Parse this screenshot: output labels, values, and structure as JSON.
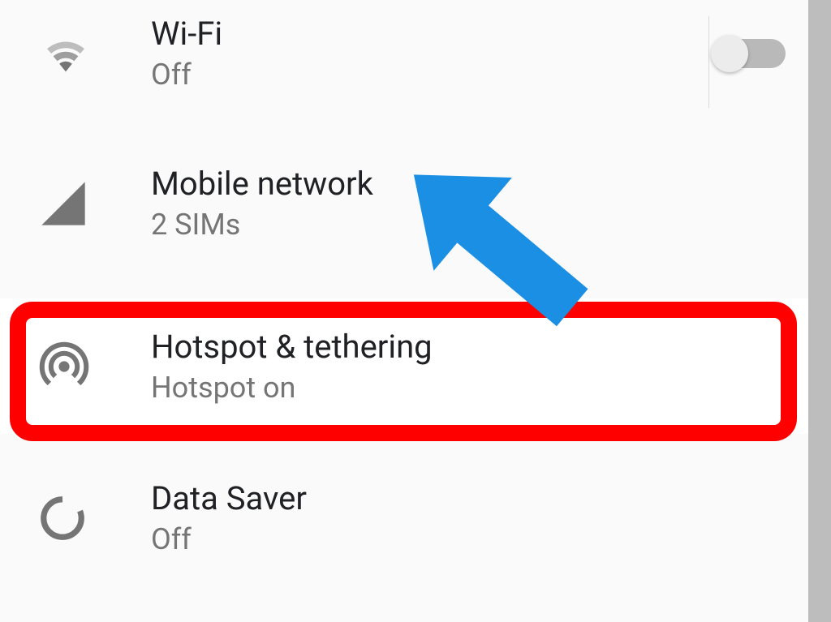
{
  "settings": {
    "wifi": {
      "title": "Wi-Fi",
      "subtitle": "Off",
      "toggled": false
    },
    "mobile_network": {
      "title": "Mobile network",
      "subtitle": "2 SIMs"
    },
    "hotspot": {
      "title": "Hotspot & tethering",
      "subtitle": "Hotspot on"
    },
    "data_saver": {
      "title": "Data Saver",
      "subtitle": "Off"
    }
  },
  "annotation": {
    "highlight_color": "#ff0000",
    "arrow_color": "#1e90ff",
    "highlighted_item": "hotspot"
  }
}
